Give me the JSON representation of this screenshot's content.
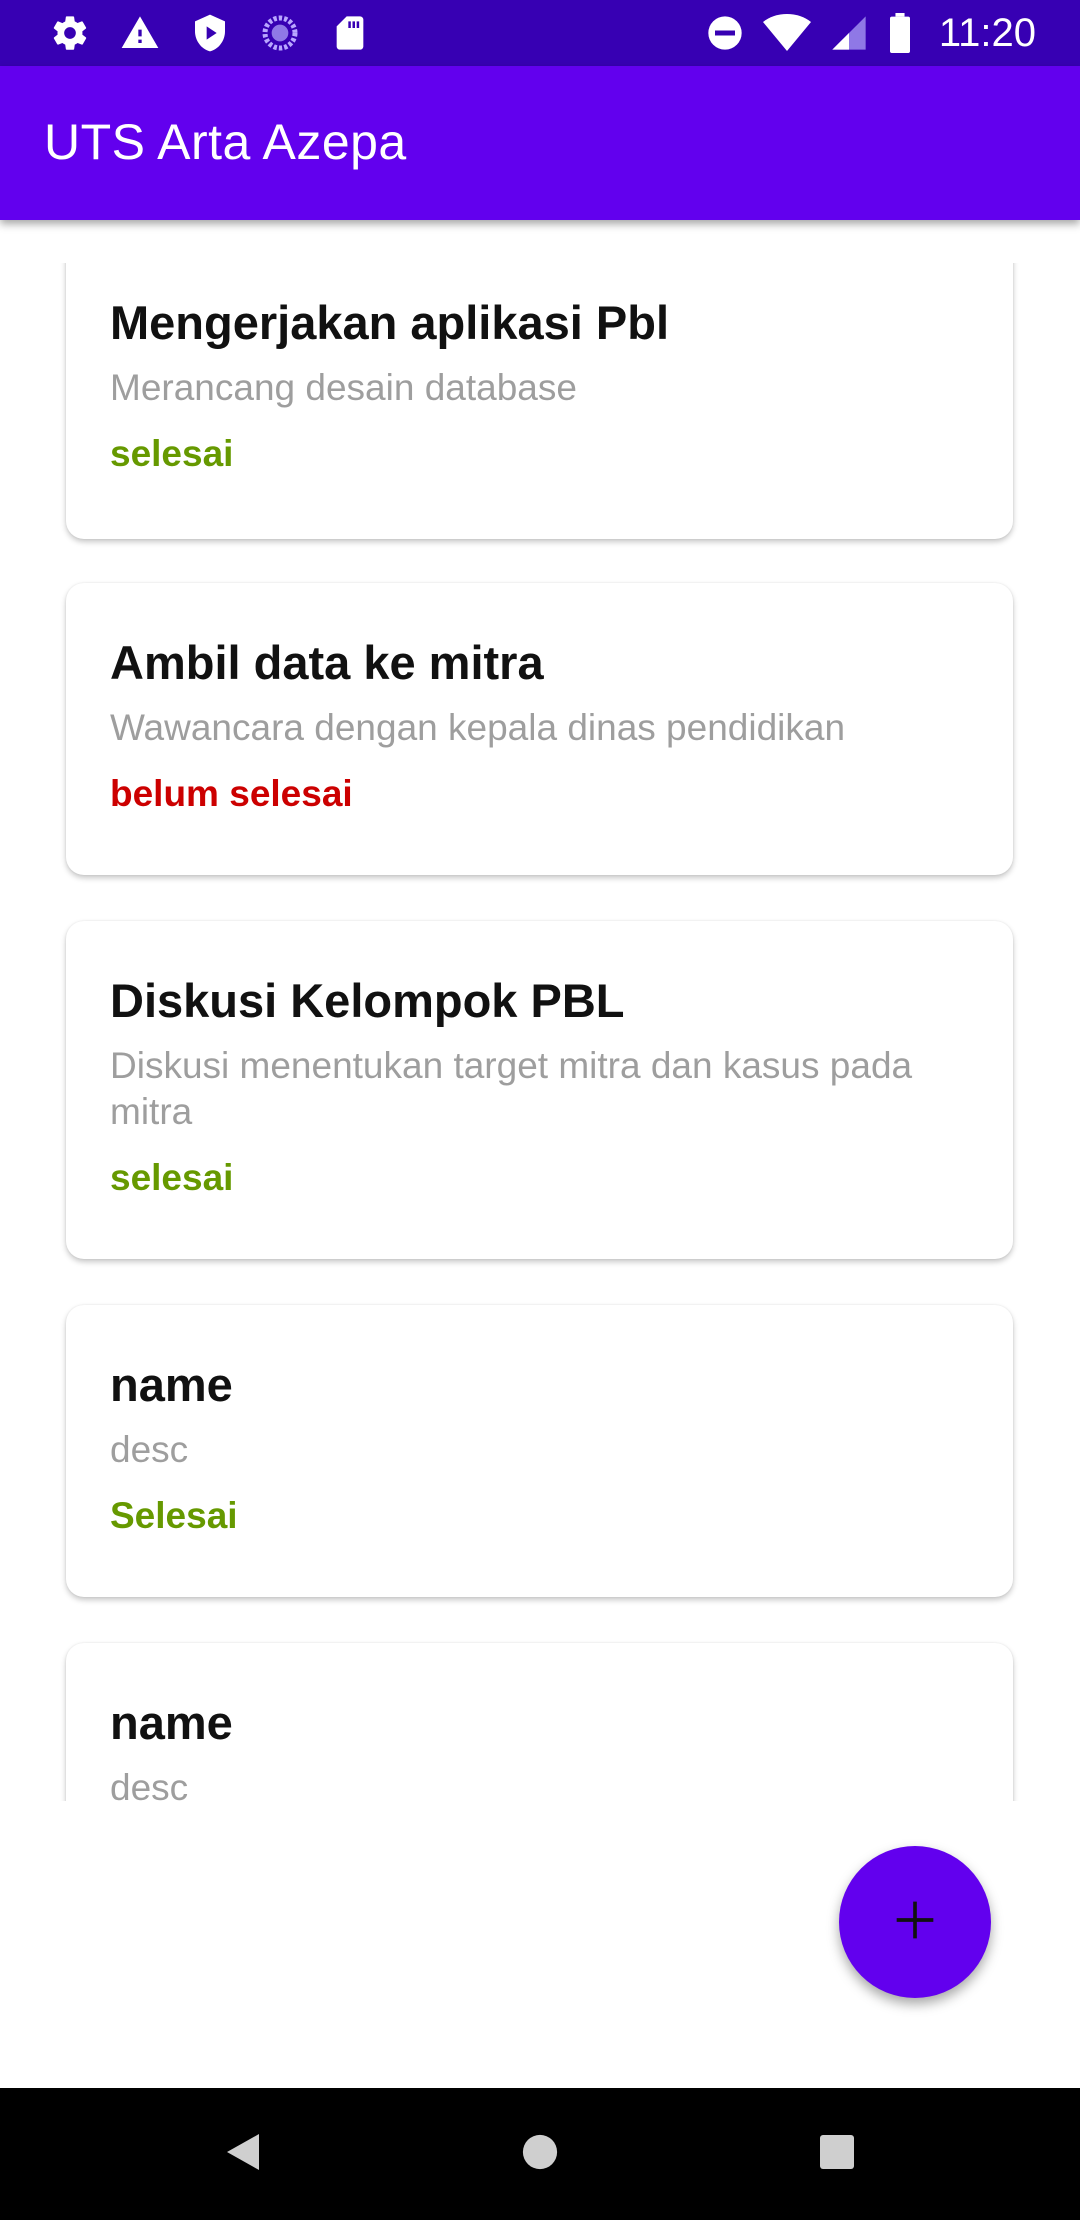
{
  "status_bar": {
    "time": "11:20",
    "left_icons": [
      "settings-icon",
      "warning-icon",
      "play-protect-icon",
      "sync-circle-icon",
      "sd-card-icon"
    ],
    "right_icons": [
      "do-not-disturb-icon",
      "wifi-icon",
      "cell-signal-icon",
      "battery-icon"
    ],
    "background": "#3700b3"
  },
  "app_bar": {
    "title": "UTS Arta Azepa",
    "background": "#6200ee"
  },
  "tasks": [
    {
      "name": "Mengerjakan aplikasi Pbl",
      "desc": "Merancang desain database",
      "status": "selesai",
      "status_color": "#669900"
    },
    {
      "name": "Ambil data ke mitra",
      "desc": "Wawancara dengan kepala dinas pendidikan",
      "status": "belum selesai",
      "status_color": "#cc0000"
    },
    {
      "name": "Diskusi Kelompok PBL",
      "desc": "Diskusi menentukan target mitra dan kasus pada mitra",
      "status": "selesai",
      "status_color": "#669900"
    },
    {
      "name": "name",
      "desc": "desc",
      "status": "Selesai",
      "status_color": "#669900"
    },
    {
      "name": "name",
      "desc": "desc",
      "status": "",
      "status_color": "#669900"
    }
  ],
  "fab": {
    "icon": "plus-icon",
    "color": "#6200ee"
  },
  "nav_bar": {
    "buttons": [
      "back-icon",
      "home-icon",
      "recents-icon"
    ]
  }
}
